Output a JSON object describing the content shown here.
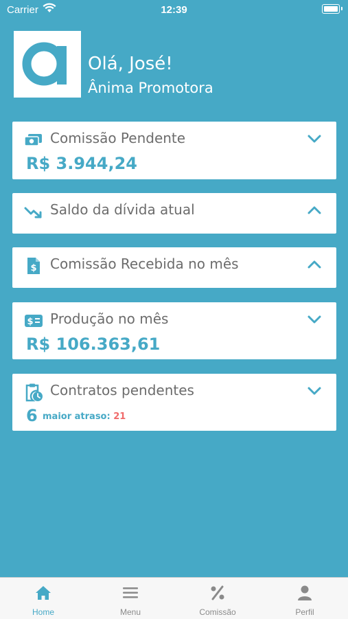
{
  "colors": {
    "brand": "#46a9c6",
    "card": "#ffffff",
    "alert": "#f06a6a",
    "tab_inactive": "#8a8a8a"
  },
  "status_bar": {
    "carrier": "Carrier",
    "time": "12:39"
  },
  "header": {
    "greeting": "Olá, José!",
    "company": "Ânima Promotora",
    "logo_icon": "anima-logo-icon"
  },
  "cards": {
    "pending_commission": {
      "title": "Comissão Pendente",
      "value": "R$ 3.944,24",
      "icon": "money-icon",
      "chevron": "chevron-down-icon"
    },
    "debt_balance": {
      "title": "Saldo da dívida atual",
      "icon": "trending-down-icon",
      "chevron": "chevron-up-icon"
    },
    "received_commission": {
      "title": "Comissão Recebida no mês",
      "icon": "dollar-document-icon",
      "chevron": "chevron-up-icon"
    },
    "production": {
      "title": "Produção no mês",
      "value": "R$ 106.363,61",
      "icon": "dollar-card-icon",
      "chevron": "chevron-down-icon"
    },
    "pending_contracts": {
      "title": "Contratos pendentes",
      "count": "6",
      "delay_label": "maior atraso:",
      "delay_value": "21",
      "icon": "clipboard-clock-icon",
      "chevron": "chevron-down-icon"
    }
  },
  "tabs": [
    {
      "label": "Home",
      "icon": "home-icon",
      "active": true
    },
    {
      "label": "Menu",
      "icon": "menu-icon",
      "active": false
    },
    {
      "label": "Comissão",
      "icon": "percent-icon",
      "active": false
    },
    {
      "label": "Perfil",
      "icon": "user-icon",
      "active": false
    }
  ]
}
